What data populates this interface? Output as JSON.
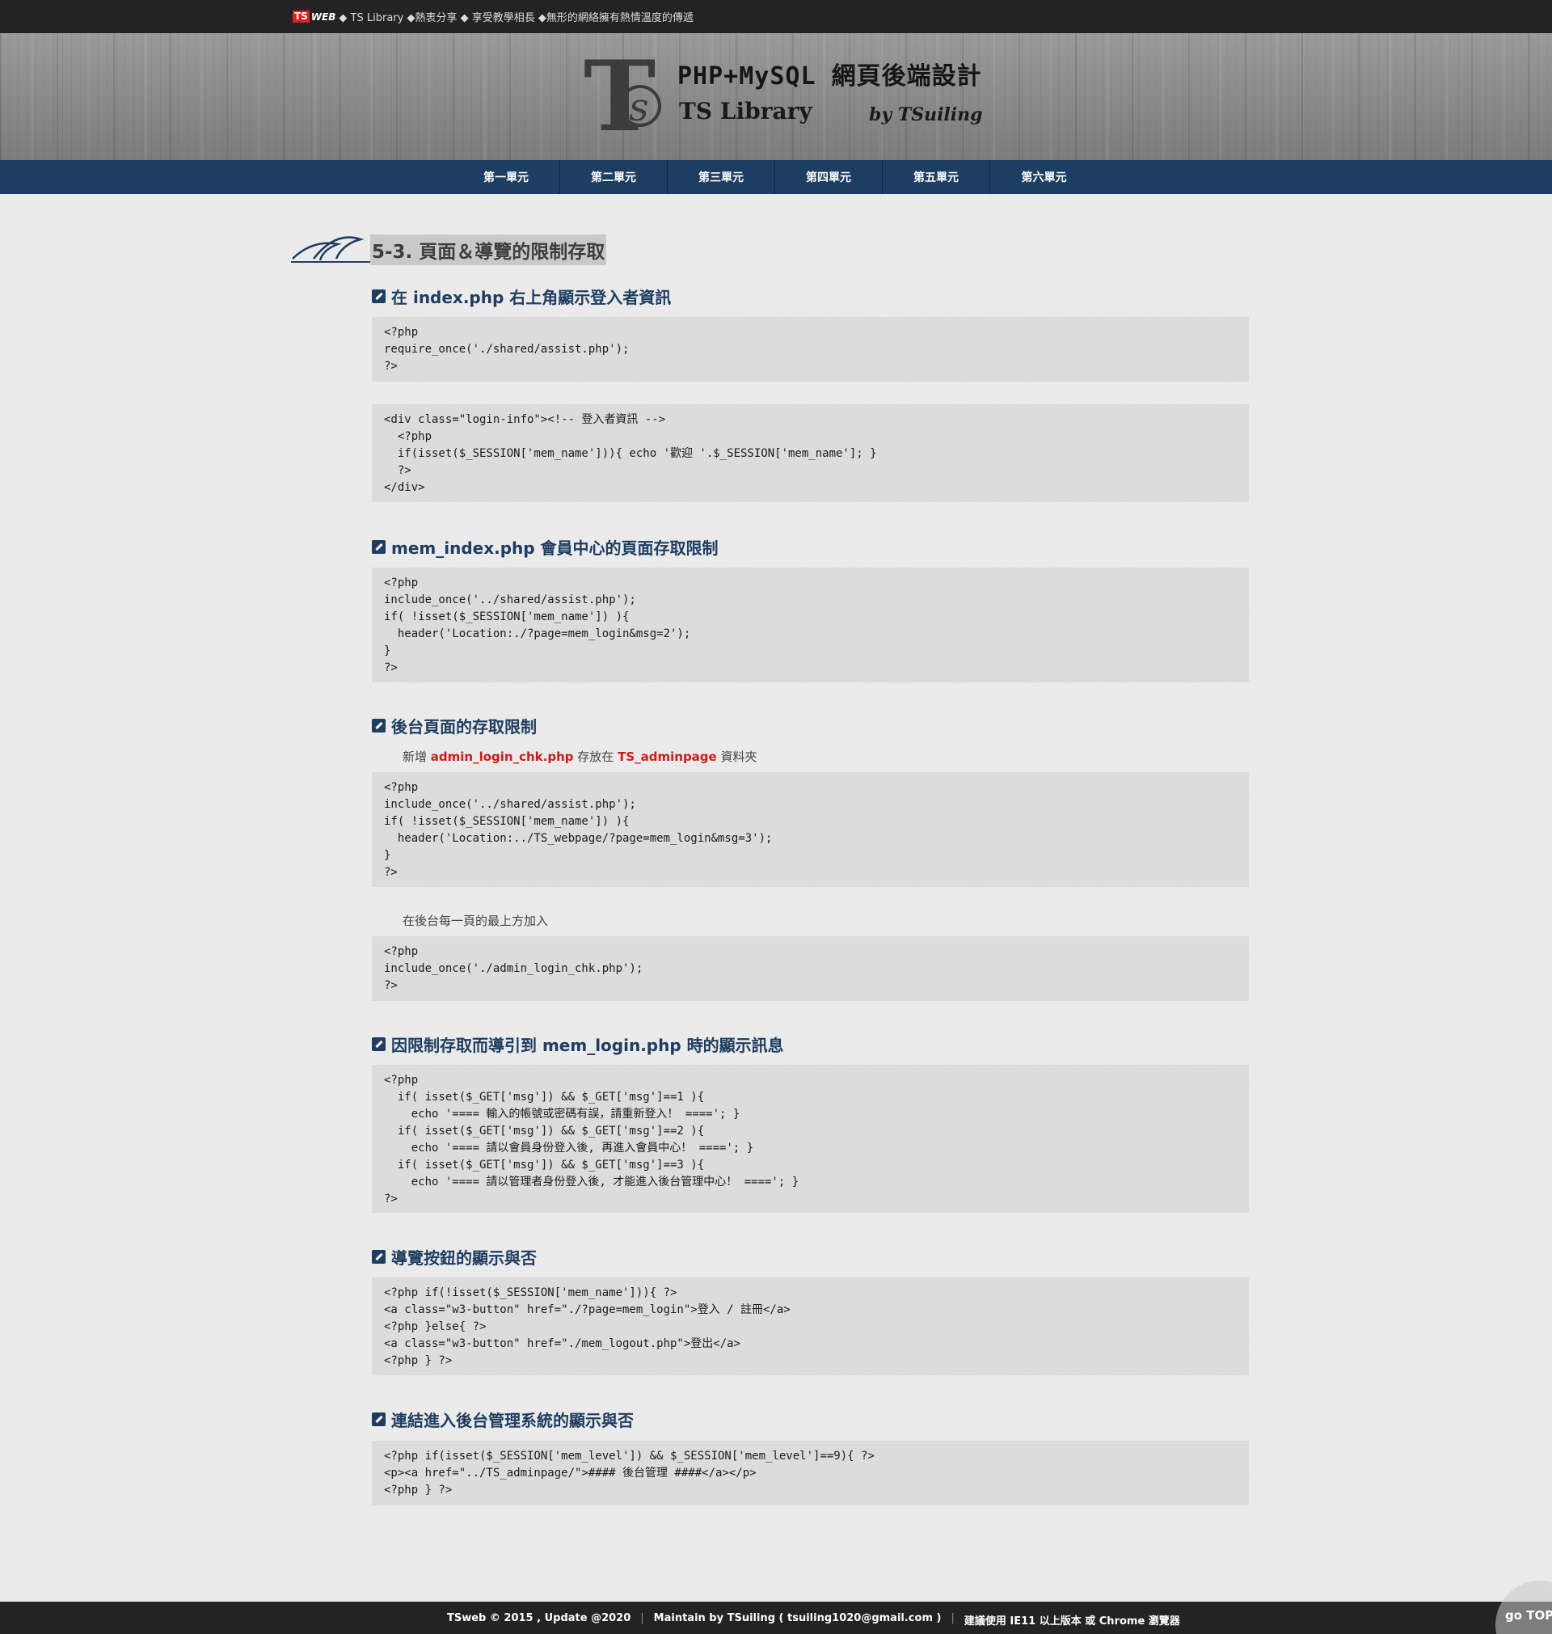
{
  "topbar": {
    "logo_ts": "TS",
    "logo_web": "WEB",
    "tagline": "◆ TS Library ◆熱衷分享 ◆ 享受教學相長 ◆無形的網絡擁有熱情溫度的傳遞"
  },
  "banner": {
    "title": "PHP+MySQL 網頁後端設計",
    "subtitle": "TS Library",
    "byline": "by TSuiling"
  },
  "nav": {
    "items": [
      "第一單元",
      "第二單元",
      "第三單元",
      "第四單元",
      "第五單元",
      "第六單元"
    ]
  },
  "page": {
    "heading": "5-3. 頁面＆導覽的限制存取"
  },
  "sections": {
    "s1": {
      "title": "在 index.php 右上角顯示登入者資訊"
    },
    "s2": {
      "title": "mem_index.php 會員中心的頁面存取限制"
    },
    "s3": {
      "title": "後台頁面的存取限制",
      "note_prefix": "新增",
      "note_file": "admin_login_chk.php",
      "note_mid": "存放在",
      "note_folder": "TS_adminpage",
      "note_suffix": "資料夾",
      "note2": "在後台每一頁的最上方加入"
    },
    "s4": {
      "title": "因限制存取而導引到 mem_login.php 時的顯示訊息"
    },
    "s5": {
      "title": "導覽按鈕的顯示與否"
    },
    "s6": {
      "title": "連結進入後台管理系統的顯示與否"
    }
  },
  "code": {
    "c1a": "<?php\nrequire_once('./shared/assist.php');\n?>",
    "c1b": "<div class=\"login-info\"><!-- 登入者資訊 -->\n  <?php\n  if(isset($_SESSION['mem_name'])){ echo '歡迎 '.$_SESSION['mem_name']; }\n  ?>\n</div>",
    "c2": "<?php\ninclude_once('../shared/assist.php');\nif( !isset($_SESSION['mem_name']) ){\n  header('Location:./?page=mem_login&msg=2');\n}\n?>",
    "c3a": "<?php\ninclude_once('../shared/assist.php');\nif( !isset($_SESSION['mem_name']) ){\n  header('Location:../TS_webpage/?page=mem_login&msg=3');\n}\n?>",
    "c3b": "<?php\ninclude_once('./admin_login_chk.php');\n?>",
    "c4": "<?php\n  if( isset($_GET['msg']) && $_GET['msg']==1 ){\n    echo '==== 輸入的帳號或密碼有誤，請重新登入！ ===='; }\n  if( isset($_GET['msg']) && $_GET['msg']==2 ){\n    echo '==== 請以會員身份登入後, 再進入會員中心！ ===='; }\n  if( isset($_GET['msg']) && $_GET['msg']==3 ){\n    echo '==== 請以管理者身份登入後, 才能進入後台管理中心！ ===='; }\n?>",
    "c5": "<?php if(!isset($_SESSION['mem_name'])){ ?>\n<a class=\"w3-button\" href=\"./?page=mem_login\">登入 / 註冊</a>\n<?php }else{ ?>\n<a class=\"w3-button\" href=\"./mem_logout.php\">登出</a>\n<?php } ?>",
    "c6": "<?php if(isset($_SESSION['mem_level']) && $_SESSION['mem_level']==9){ ?>\n<p><a href=\"../TS_adminpage/\">#### 後台管理 ####</a></p>\n<?php } ?>"
  },
  "footer": {
    "copyright": "TSweb © 2015 , Update @2020",
    "maintain": "Maintain by TSuiling ( tsuiling1020@gmail.com )",
    "browser": "建議使用 IE11 以上版本 或 Chrome 瀏覽器"
  },
  "gotop": {
    "label": "go TOP"
  }
}
